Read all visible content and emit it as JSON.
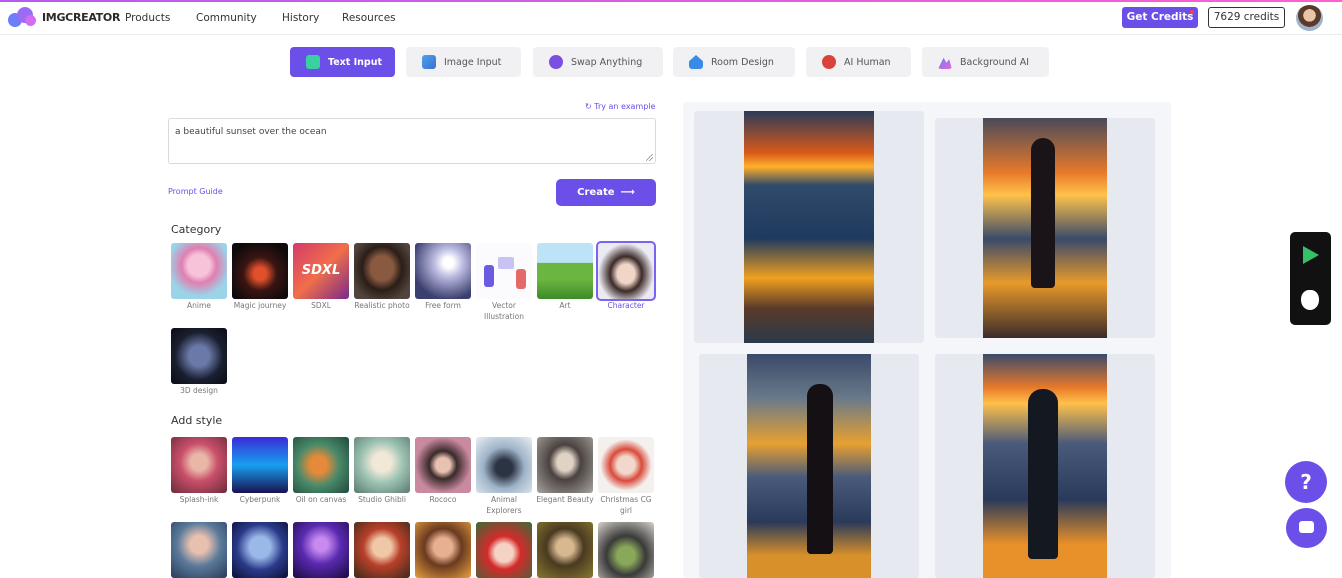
{
  "brand": {
    "name": "IMGCREATOR"
  },
  "nav": [
    "Products",
    "Community",
    "History",
    "Resources"
  ],
  "header": {
    "get_credits": "Get Credits",
    "credits": "7629 credits"
  },
  "tabs": [
    "Text Input",
    "Image Input",
    "Swap Anything",
    "Room Design",
    "AI Human",
    "Background AI"
  ],
  "prompt": {
    "try_example": "Try an example",
    "value": "a beautiful sunset over the ocean",
    "guide": "Prompt Guide",
    "create": "Create"
  },
  "category": {
    "title": "Category",
    "items": [
      "Anime",
      "Magic journey",
      "SDXL",
      "Realistic photo",
      "Free form",
      "Vector Illustration",
      "Art",
      "Character",
      "3D design"
    ],
    "selected": "Character"
  },
  "style": {
    "title": "Add style",
    "items": [
      "Splash-ink",
      "Cyberpunk",
      "Oil on canvas",
      "Studio Ghibli",
      "Rococo",
      "Animal Explorers",
      "Elegant Beauty",
      "Christmas CG girl"
    ]
  },
  "icons": {
    "try": "refresh-icon",
    "create": "arrow-right-icon",
    "play": "google-play-icon",
    "apple": "apple-icon",
    "help": "question-icon",
    "chat": "chat-icon"
  },
  "colors": {
    "accent": "#6c4ee8"
  }
}
